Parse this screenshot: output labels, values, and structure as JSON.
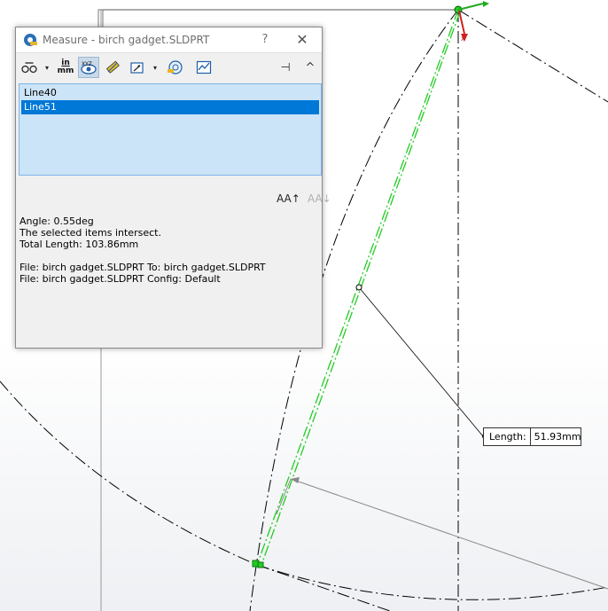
{
  "dialog": {
    "title": "Measure - birch gadget.SLDPRT",
    "help_glyph": "?",
    "close_glyph": "✕",
    "toolbar": {
      "units_top": "in",
      "units_bottom": "mm",
      "caret": "▾",
      "pin_glyph": "⊣",
      "collapse_glyph": "^"
    },
    "selection_list": [
      "Line40",
      "Line51"
    ],
    "selected_index": 1,
    "font_icons": [
      "AA↑",
      "AA↓"
    ],
    "results": {
      "angle": "Angle: 0.55deg",
      "intersect": "The selected items intersect.",
      "total_length": "Total Length: 103.86mm",
      "file_to": "File: birch gadget.SLDPRT To: birch gadget.SLDPRT",
      "file_config": "File: birch gadget.SLDPRT Config: Default"
    }
  },
  "graphics": {
    "length_label": {
      "name": "Length:",
      "value": "51.93mm"
    },
    "colors": {
      "sketch_line": "#000000",
      "selected_line": "#22cc22",
      "endpoint": "#22cc22",
      "x_axis": "#cc2222",
      "y_axis": "#22aa22"
    }
  }
}
